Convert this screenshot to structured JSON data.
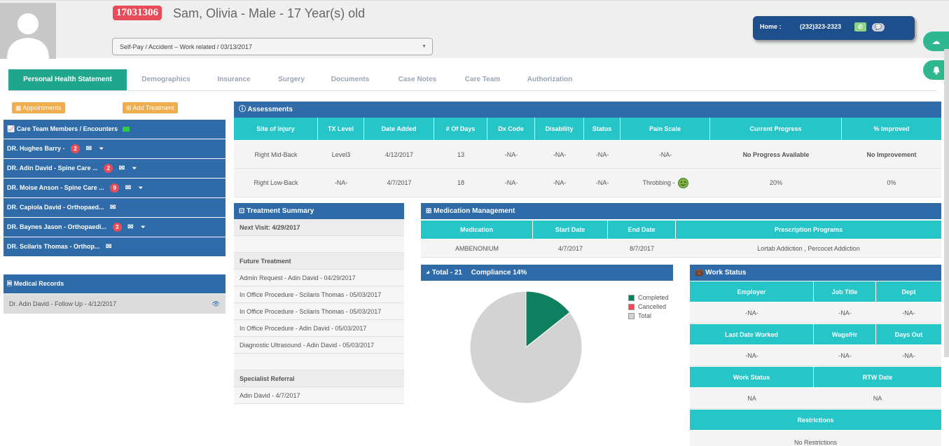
{
  "patient": {
    "mrn": "17031306",
    "name_line": "Sam, Olivia - Male - 17 Year(s) old",
    "case_selected": "Self-Pay / Accident – Work related / 03/13/2017"
  },
  "contact": {
    "label": "Home :",
    "phone": "(232)323-2323"
  },
  "tabs": [
    {
      "label": "Personal Health Statement",
      "active": true
    },
    {
      "label": "Demographics"
    },
    {
      "label": "Insurance"
    },
    {
      "label": "Surgery"
    },
    {
      "label": "Documents"
    },
    {
      "label": "Case Notes"
    },
    {
      "label": "Care Team"
    },
    {
      "label": "Authorization"
    }
  ],
  "actions": {
    "appointments": "Appointments",
    "add_treatment": "Add Treatment"
  },
  "care_team": {
    "title": "Care Team Members / Encounters",
    "members": [
      {
        "name": "DR. Hughes Barry -",
        "badge": "2"
      },
      {
        "name": "DR. Adin David - Spine Care ...",
        "badge": "2"
      },
      {
        "name": "DR. Moise Anson - Spine Care ...",
        "badge": "9"
      },
      {
        "name": "DR. Capiola David - Orthopaed...",
        "badge": ""
      },
      {
        "name": "DR. Baynes Jason - Orthopaedi...",
        "badge": "3"
      },
      {
        "name": "DR. Scilaris Thomas - Orthop...",
        "badge": ""
      }
    ]
  },
  "medical_records": {
    "title": "Medical Records",
    "items": [
      "Dr. Adin David - Follow Up - 4/12/2017"
    ]
  },
  "assessments": {
    "title": "Assessments",
    "columns": [
      "Site of Injury",
      "TX Level",
      "Date Added",
      "# Of Days",
      "Dx Code",
      "Disability",
      "Status",
      "Pain Scale",
      "Current Progress",
      "% Improved"
    ],
    "rows": [
      [
        "Right Mid-Back",
        "Level3",
        "4/12/2017",
        "13",
        "-NA-",
        "-NA-",
        "-NA-",
        "-NA-",
        "No Progress Available",
        "No Improvement"
      ],
      [
        "Right Low-Back",
        "-NA-",
        "4/7/2017",
        "18",
        "-NA-",
        "-NA-",
        "-NA-",
        "Throbbing -",
        "20%",
        "0%"
      ]
    ]
  },
  "treatment_summary": {
    "title": "Treatment Summary",
    "next_visit": "Next Visit: 4/29/2017",
    "future_label": "Future Treatment",
    "future": [
      "Admin Request - Adin David - 04/29/2017",
      "In Office Procedure - Scilaris Thomas - 05/03/2017",
      "In Office Procedure - Scilaris Thomas - 05/03/2017",
      "In Office Procedure - Adin David - 05/03/2017",
      "Diagnostic Ultrasound - Adin David - 05/03/2017"
    ],
    "referral_label": "Specialist Referral",
    "referrals": [
      "Adin David - 4/7/2017"
    ]
  },
  "medication": {
    "title": "Medication Management",
    "columns": [
      "Medication",
      "Start Date",
      "End Date",
      "Prescription Programs"
    ],
    "rows": [
      [
        "AMBENONIUM",
        "4/7/2017",
        "8/7/2017",
        "Lortab Addiction , Percocet Addiction"
      ]
    ]
  },
  "compliance": {
    "title": "Total - 21",
    "compliance_label": "Compliance 14%",
    "colors": {
      "completed": "#0e7f5f",
      "cancelled": "#ef4b5b",
      "total": "#d3d3d3"
    }
  },
  "chart_data": {
    "type": "pie",
    "labels": [
      "Completed",
      "Cancelled",
      "Total"
    ],
    "values": [
      3,
      0,
      18
    ]
  },
  "work_status": {
    "title": "Work Status",
    "h1": [
      "Employer",
      "Job Title",
      "Dept"
    ],
    "v1": [
      "-NA-",
      "-NA-",
      "-NA-"
    ],
    "h2": [
      "Last Date Worked",
      "Wage/Hr",
      "Days Out"
    ],
    "v2": [
      "-NA-",
      "-NA-",
      "-NA-"
    ],
    "h3": [
      "Work Status",
      "RTW Date"
    ],
    "v3": [
      "NA",
      "NA"
    ],
    "h4": "Restrictions",
    "v4": "No Restrictions"
  }
}
